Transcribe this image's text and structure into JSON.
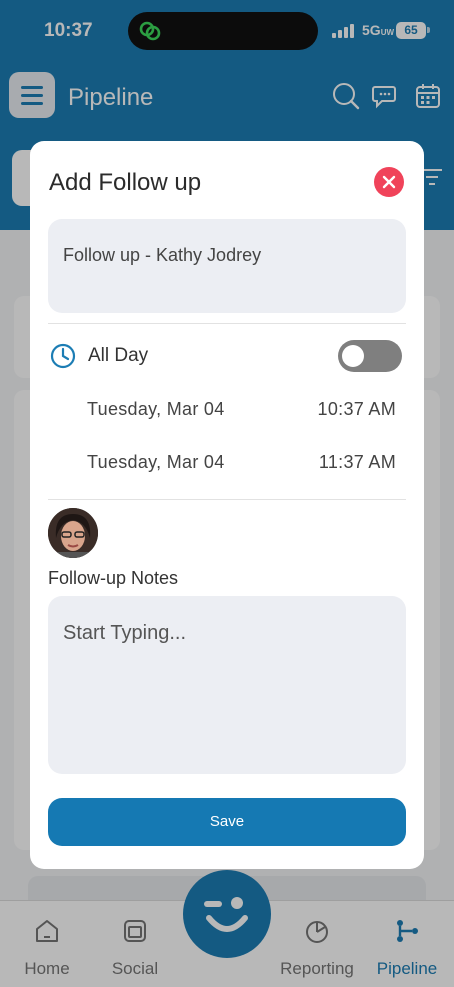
{
  "status_bar": {
    "time": "10:37",
    "network": "5G",
    "network_suffix": "UW",
    "battery": "65"
  },
  "header": {
    "title": "Pipeline"
  },
  "modal": {
    "title": "Add Follow up",
    "title_field_value": "Follow up - Kathy Jodrey",
    "all_day_label": "All Day",
    "all_day_on": false,
    "start_date": "Tuesday, Mar 04",
    "start_time": "10:37 AM",
    "end_date": "Tuesday, Mar 04",
    "end_time": "11:37 AM",
    "notes_label": "Follow-up Notes",
    "notes_placeholder": "Start Typing...",
    "save_label": "Save"
  },
  "tabbar": {
    "items": [
      {
        "label": "Home",
        "icon": "home-icon"
      },
      {
        "label": "Social",
        "icon": "social-icon"
      },
      {
        "label": "Reporting",
        "icon": "pie-chart-icon"
      },
      {
        "label": "Pipeline",
        "icon": "pipeline-icon",
        "active": true
      }
    ]
  },
  "colors": {
    "brand": "#1c7db4",
    "close": "#f0435a",
    "toggle_off": "#7f7f7f"
  }
}
